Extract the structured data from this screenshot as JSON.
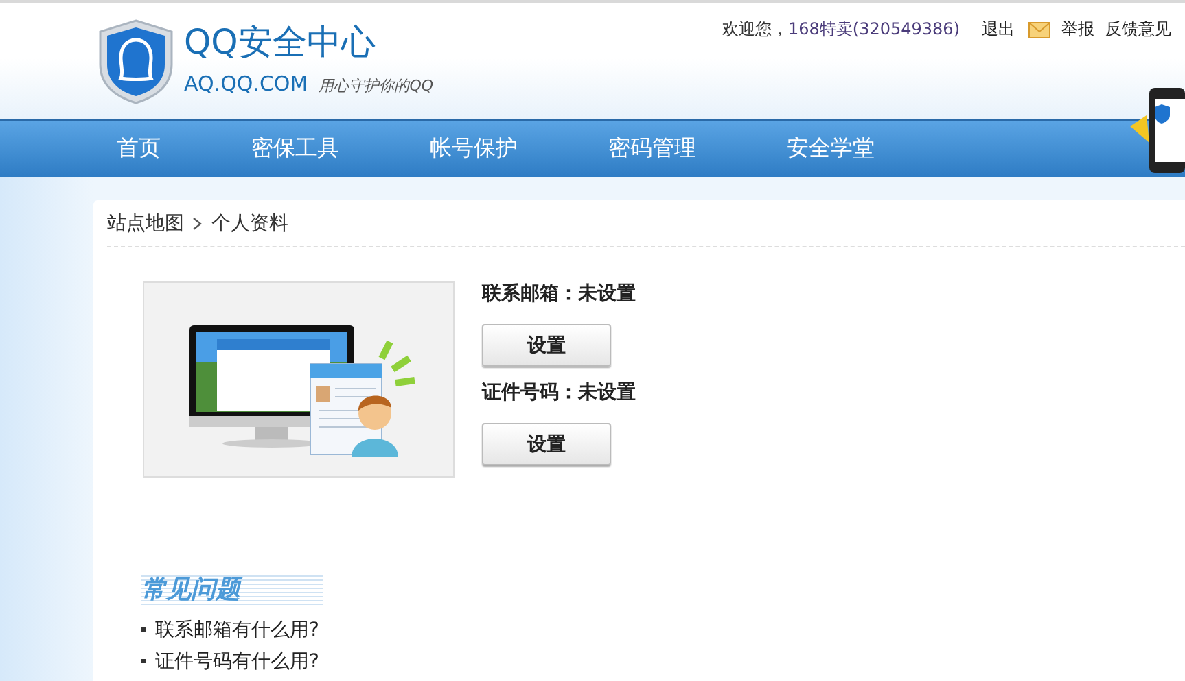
{
  "header": {
    "title": "QQ安全中心",
    "domain": "AQ.QQ.COM",
    "slogan": "用心守护你的QQ",
    "welcome": "欢迎您，",
    "user": "168特卖(320549386)",
    "links": [
      "退出",
      "举报",
      "反馈意见"
    ]
  },
  "nav": [
    {
      "label": "首页"
    },
    {
      "label": "密保工具"
    },
    {
      "label": "帐号保护"
    },
    {
      "label": "密码管理"
    },
    {
      "label": "安全学堂"
    }
  ],
  "breadcrumb": [
    "站点地图",
    "个人资料"
  ],
  "fields": [
    {
      "label": "联系邮箱：未设置",
      "button": "设置"
    },
    {
      "label": "证件号码：未设置",
      "button": "设置"
    }
  ],
  "faq": {
    "title": "常见问题",
    "items": [
      "联系邮箱有什么用?",
      "证件号码有什么用?"
    ]
  }
}
